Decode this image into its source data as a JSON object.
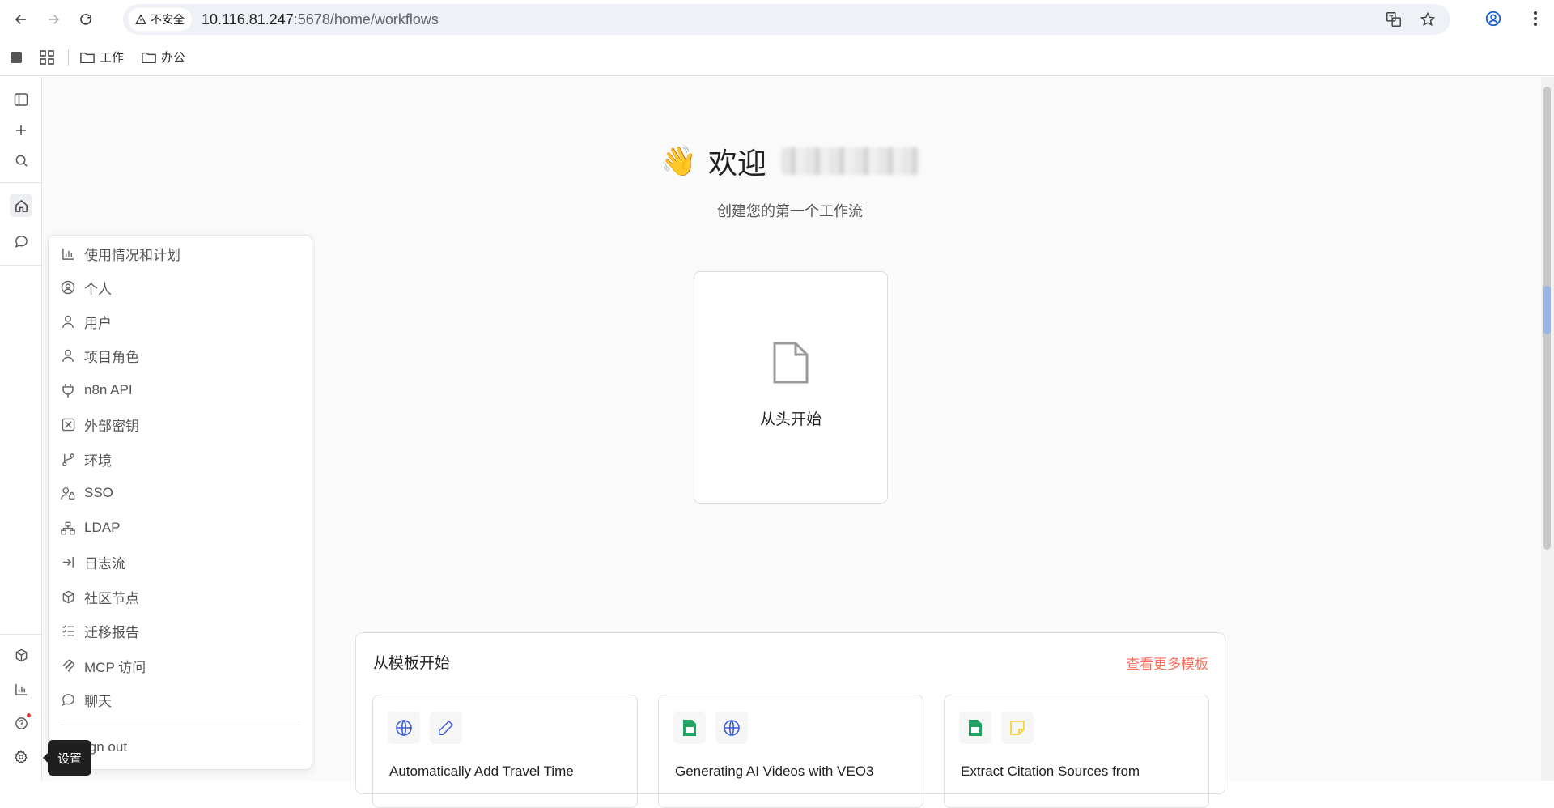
{
  "browser": {
    "security_label": "不安全",
    "url_host": "10.116.81.247",
    "url_rest": ":5678/home/workflows",
    "bookmarks": [
      {
        "label": "工作"
      },
      {
        "label": "办公"
      }
    ]
  },
  "main": {
    "welcome_text": "欢迎",
    "wave_emoji": "👋",
    "subtitle": "创建您的第一个工作流",
    "start_card_label": "从头开始"
  },
  "templates": {
    "heading": "从模板开始",
    "more_link": "查看更多模板",
    "cards": [
      {
        "title": "Automatically Add Travel Time",
        "icons": [
          "globe-icon",
          "pencil-icon"
        ]
      },
      {
        "title": "Generating AI Videos with VEO3",
        "icons": [
          "google-sheets-icon",
          "globe-icon"
        ]
      },
      {
        "title": "Extract Citation Sources from",
        "icons": [
          "google-sheets-icon",
          "sticky-note-icon"
        ]
      }
    ]
  },
  "settings_menu": {
    "items": [
      {
        "label": "使用情况和计划",
        "icon": "bar-chart-icon"
      },
      {
        "label": "个人",
        "icon": "user-circle-icon"
      },
      {
        "label": "用户",
        "icon": "user-icon"
      },
      {
        "label": "项目角色",
        "icon": "user-icon"
      },
      {
        "label": "n8n API",
        "icon": "plug-icon"
      },
      {
        "label": "外部密钥",
        "icon": "vault-icon"
      },
      {
        "label": "环境",
        "icon": "git-branch-icon"
      },
      {
        "label": "SSO",
        "icon": "user-lock-icon"
      },
      {
        "label": "LDAP",
        "icon": "network-icon"
      },
      {
        "label": "日志流",
        "icon": "log-in-icon"
      },
      {
        "label": "社区节点",
        "icon": "box-icon"
      },
      {
        "label": "迁移报告",
        "icon": "list-checks-icon"
      },
      {
        "label": "MCP 访问",
        "icon": "mcp-icon"
      },
      {
        "label": "聊天",
        "icon": "chat-icon"
      }
    ],
    "sign_out": "ign out"
  },
  "tooltip": {
    "text": "设置"
  },
  "colors": {
    "accent": "#ff6d5a",
    "sheets_green": "#1fa463",
    "note_yellow": "#f5d33f",
    "globe_blue": "#3c5bd6"
  }
}
